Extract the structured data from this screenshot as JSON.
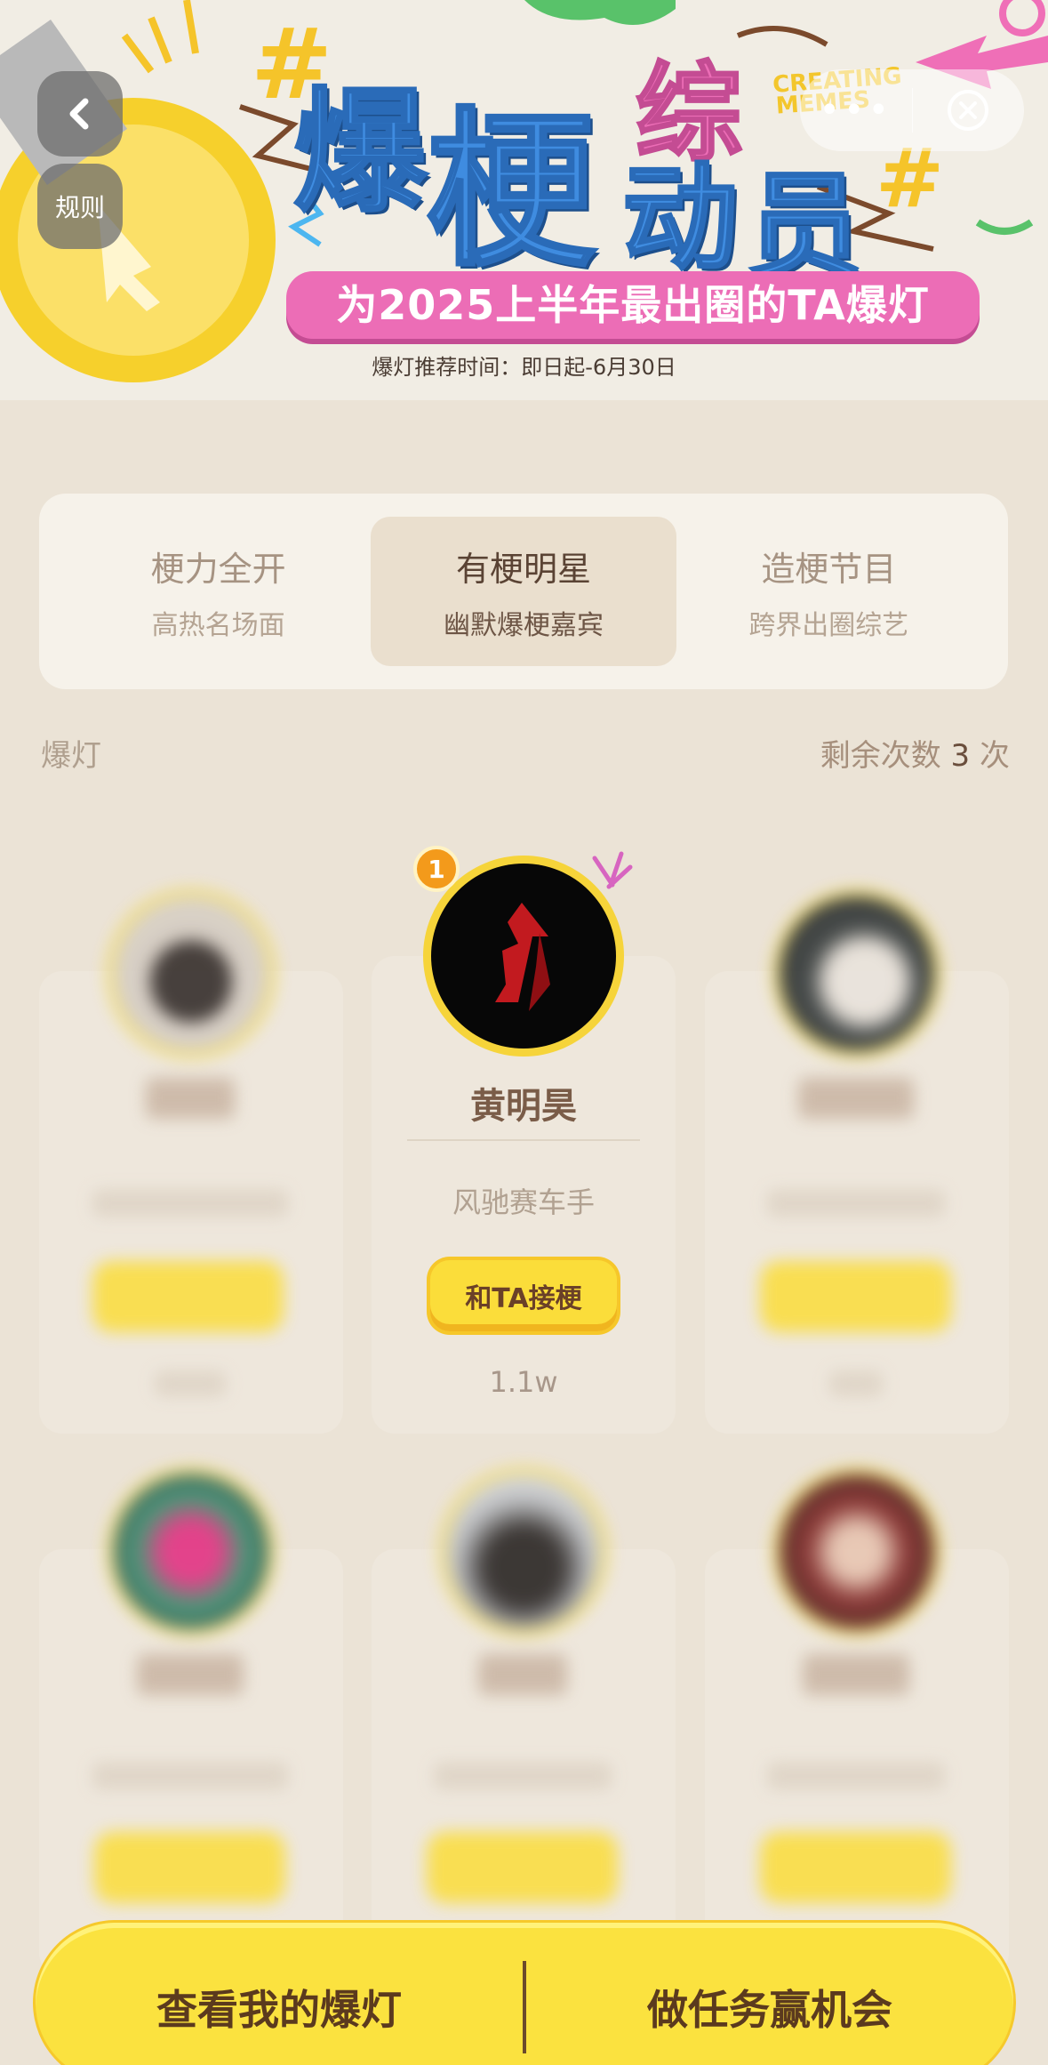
{
  "banner": {
    "title_chars": [
      "爆",
      "梗",
      "综",
      "动",
      "员"
    ],
    "tag": "CREATING MEMES",
    "slogan": "为2025上半年最出圈的TA爆灯",
    "subtitle": "爆灯推荐时间：即日起-6月30日"
  },
  "controls": {
    "back_icon": "chevron-left-icon",
    "rules_label": "规则",
    "more_label": "•••",
    "close_icon": "close-circle-icon"
  },
  "tabs": [
    {
      "title": "梗力全开",
      "subtitle": "高热名场面"
    },
    {
      "title": "有梗明星",
      "subtitle": "幽默爆梗嘉宾"
    },
    {
      "title": "造梗节目",
      "subtitle": "跨界出圈综艺"
    }
  ],
  "active_tab": 1,
  "info": {
    "left_label": "爆灯",
    "remain_prefix": "剩余次数",
    "remain_count": "3",
    "remain_suffix": "次"
  },
  "featured": {
    "rank": "1",
    "name": "黄明昊",
    "role": "风驰赛车手",
    "button": "和TA接梗",
    "count": "1.1w"
  },
  "bottom": {
    "left": "查看我的爆灯",
    "right": "做任务赢机会"
  },
  "colors": {
    "accent_yellow": "#fbdd3a",
    "brand_pink": "#ec6db6",
    "brand_blue": "#3f8ce0",
    "text_brown": "#7a5c48"
  }
}
